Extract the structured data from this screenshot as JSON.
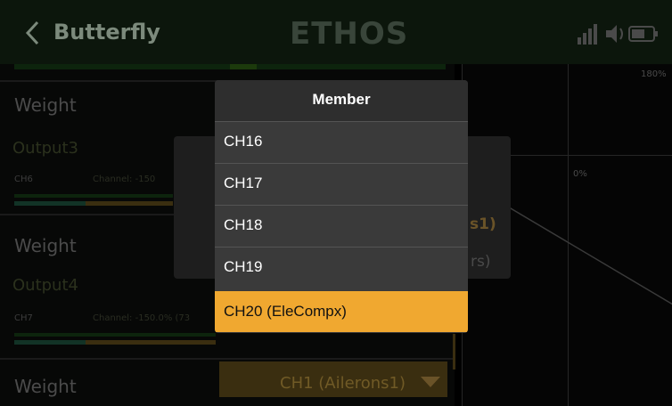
{
  "header": {
    "title": "Butterfly",
    "brand": "ETHOS"
  },
  "left_panel": {
    "weight_label_1": "Weight",
    "output3_label": "Output3",
    "ch6_label": "CH6",
    "ch6_channel_text": "Channel: -150",
    "weight_label_2": "Weight",
    "output4_label": "Output4",
    "ch7_label": "CH7",
    "ch7_channel_text": "Channel: -150.0% (73",
    "weight_label_3": "Weight",
    "bottom_select_value": "CH1 (Ailerons1)"
  },
  "graph": {
    "label_top": "180%",
    "label_mid": "0%"
  },
  "inner_dialog": {
    "value_1": "s1)",
    "value_2": "rs)"
  },
  "popup": {
    "title": "Member",
    "items": [
      {
        "label": "CH16",
        "selected": false
      },
      {
        "label": "CH17",
        "selected": false
      },
      {
        "label": "CH18",
        "selected": false
      },
      {
        "label": "CH19",
        "selected": false
      },
      {
        "label": "CH20 (EleCompx)",
        "selected": true
      }
    ]
  },
  "colors": {
    "accent": "#f0a830",
    "popup_bg": "#3a3a3a",
    "header_bg": "#2e2e2e"
  },
  "icons": [
    "back-arrow-icon",
    "signal-icon",
    "speaker-icon",
    "battery-icon",
    "dropdown-caret-icon"
  ]
}
